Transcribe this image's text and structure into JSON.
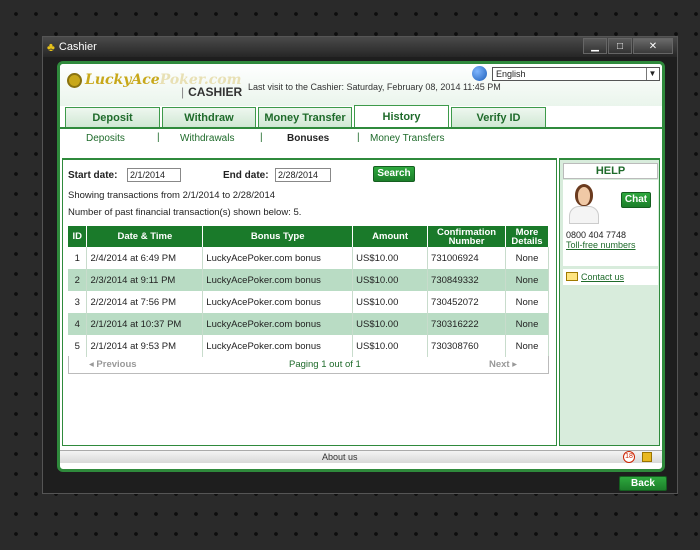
{
  "window": {
    "title": "Cashier"
  },
  "header": {
    "logo_main": "LuckyAce",
    "logo_fade": "Poker.com",
    "cashier_sep": "|",
    "cashier_title": "CASHIER",
    "last_visit": "Last visit to the Cashier: Saturday, February 08, 2014 11:45 PM",
    "language": "English"
  },
  "tabs": [
    "Deposit",
    "Withdraw",
    "Money Transfer",
    "History",
    "Verify ID"
  ],
  "subnav": {
    "deposits": "Deposits",
    "withdrawals": "Withdrawals",
    "bonuses": "Bonuses",
    "money_transfers": "Money Transfers",
    "sep": "|"
  },
  "filters": {
    "start_label": "Start date:",
    "start_value": "2/1/2014",
    "end_label": "End date:",
    "end_value": "2/28/2014",
    "search_label": "Search"
  },
  "info": {
    "showing": "Showing transactions from 2/1/2014 to 2/28/2014",
    "count": "Number of past financial transaction(s) shown below: 5."
  },
  "table": {
    "headers": [
      "ID",
      "Date & Time",
      "Bonus Type",
      "Amount",
      "Confirmation Number",
      "More Details"
    ],
    "rows": [
      [
        "1",
        "2/4/2014 at 6:49 PM",
        "LuckyAcePoker.com bonus",
        "US$10.00",
        "731006924",
        "None"
      ],
      [
        "2",
        "2/3/2014 at 9:11 PM",
        "LuckyAcePoker.com bonus",
        "US$10.00",
        "730849332",
        "None"
      ],
      [
        "3",
        "2/2/2014 at 7:56 PM",
        "LuckyAcePoker.com bonus",
        "US$10.00",
        "730452072",
        "None"
      ],
      [
        "4",
        "2/1/2014 at 10:37 PM",
        "LuckyAcePoker.com bonus",
        "US$10.00",
        "730316222",
        "None"
      ],
      [
        "5",
        "2/1/2014 at 9:53 PM",
        "LuckyAcePoker.com bonus",
        "US$10.00",
        "730308760",
        "None"
      ]
    ]
  },
  "pager": {
    "previous": "◂ Previous",
    "status": "Paging 1 out of 1",
    "next": "Next ▸"
  },
  "help": {
    "title": "HELP",
    "chat": "Chat",
    "phone": "0800 404 7748",
    "tollfree": "Toll-free numbers",
    "contact": "Contact us"
  },
  "footer": {
    "about": "About us",
    "age": "18"
  },
  "buttons": {
    "back": "Back"
  },
  "colors": {
    "accent": "#2f8a3c",
    "table_header": "#1a7a2a",
    "row_alt": "#b9dcc4",
    "logo": "#c8a81a"
  }
}
